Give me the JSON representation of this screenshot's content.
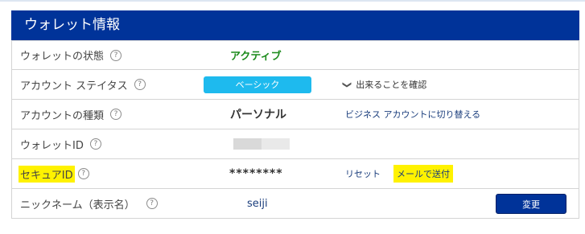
{
  "header": {
    "title": "ウォレット情報"
  },
  "help_glyph": "?",
  "rows": {
    "status": {
      "label": "ウォレットの状態",
      "value": "アクティブ"
    },
    "account_status": {
      "label": "アカウント ステイタス",
      "badge": "ベーシック",
      "link_icon": "❯",
      "link": "出来ることを確認"
    },
    "account_type": {
      "label": "アカウントの種類",
      "value": "パーソナル",
      "link": "ビジネス アカウントに切り替える"
    },
    "wallet_id": {
      "label": "ウォレットID"
    },
    "secure_id": {
      "label": "セキュアID",
      "value": "********",
      "reset_link": "リセット",
      "email_link": "メールで送付"
    },
    "nickname": {
      "label": "ニックネーム（表示名）",
      "value": "seiji",
      "button": "変更"
    }
  },
  "colors": {
    "header_bg": "#003399",
    "accent": "#1ebaee",
    "active": "#1a8a1a",
    "highlight": "#fff200"
  }
}
